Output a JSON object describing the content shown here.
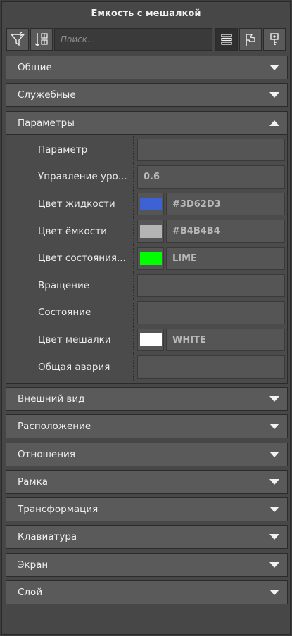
{
  "title": "Емкость с мешалкой",
  "search": {
    "placeholder": "Поиск..."
  },
  "toolbar": {
    "left_icons": [
      "filter-icon",
      "sort-icon"
    ],
    "right_icons": [
      "list-view-icon",
      "flag-icon",
      "key-icon"
    ]
  },
  "sections_before": [
    {
      "label": "Общие",
      "expanded": false
    },
    {
      "label": "Служебные",
      "expanded": false
    }
  ],
  "open_section": {
    "label": "Параметры",
    "expanded": true,
    "params": [
      {
        "name": "Параметр",
        "type": "text",
        "value": ""
      },
      {
        "name": "Управление уро...",
        "type": "text",
        "value": "0.6"
      },
      {
        "name": "Цвет жидкости",
        "type": "color",
        "value": "#3D62D3",
        "swatch": "#3D62D3"
      },
      {
        "name": "Цвет ёмкости",
        "type": "color",
        "value": "#B4B4B4",
        "swatch": "#B4B4B4"
      },
      {
        "name": "Цвет состояния...",
        "type": "color",
        "value": "LIME",
        "swatch": "#00FF00"
      },
      {
        "name": "Вращение",
        "type": "text",
        "value": ""
      },
      {
        "name": "Состояние",
        "type": "text",
        "value": ""
      },
      {
        "name": "Цвет мешалки",
        "type": "color",
        "value": "WHITE",
        "swatch": "#FFFFFF"
      },
      {
        "name": "Общая авария",
        "type": "text",
        "value": ""
      }
    ]
  },
  "sections_after": [
    {
      "label": "Внешний вид",
      "expanded": false
    },
    {
      "label": "Расположение",
      "expanded": false
    },
    {
      "label": "Отношения",
      "expanded": false
    },
    {
      "label": "Рамка",
      "expanded": false
    },
    {
      "label": "Трансформация",
      "expanded": false
    },
    {
      "label": "Клавиатура",
      "expanded": false
    },
    {
      "label": "Экран",
      "expanded": false
    },
    {
      "label": "Слой",
      "expanded": false
    }
  ]
}
